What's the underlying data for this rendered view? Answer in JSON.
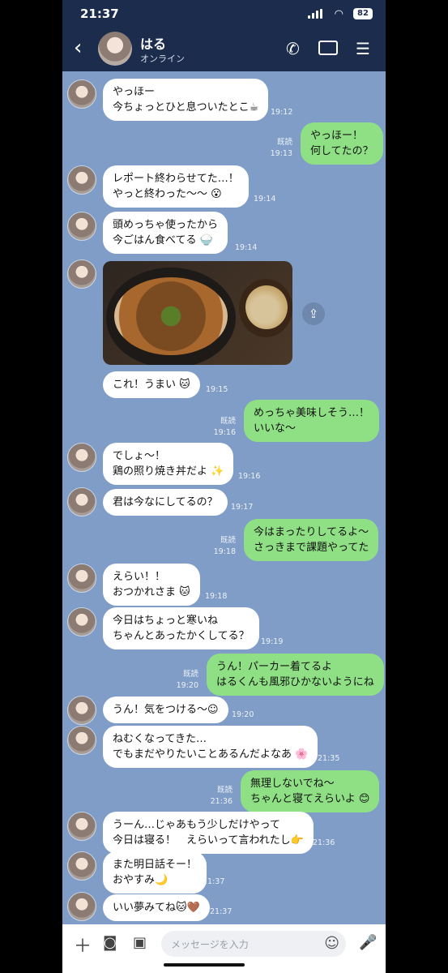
{
  "status": {
    "time": "21:37",
    "battery": "82"
  },
  "header": {
    "name": "はる",
    "status": "オンライン"
  },
  "messages": [
    {
      "text": "やっほー\n今ちょっとひと息ついたとこ☕",
      "time": "19:12"
    },
    {
      "text": "やっほー！\n何してたの？",
      "read": "既読",
      "time": "19:13"
    },
    {
      "text": "レポート終わらせてた…！\nやっと終わった〜〜 😮",
      "time": "19:14"
    },
    {
      "text": "頭めっちゃ使ったから\n今ごはん食べてる 🍚",
      "time": "19:14"
    },
    {
      "text": "これ！うまい 🐱",
      "time": "19:15"
    },
    {
      "text": "めっちゃ美味しそう…！\nいいな〜",
      "read": "既読",
      "time": "19:16"
    },
    {
      "text": "でしょ〜！\n鶏の照り焼き丼だよ ✨",
      "time": "19:16"
    },
    {
      "text": "君は今なにしてるの？",
      "time": "19:17"
    },
    {
      "text": "今はまったりしてるよ〜\nさっきまで課題やってた",
      "read": "既読",
      "time": "19:18"
    },
    {
      "text": "えらい！！\nおつかれさま 🐱",
      "time": "19:18"
    },
    {
      "text": "今日はちょっと寒いね\nちゃんとあったかくしてる？",
      "time": "19:19"
    },
    {
      "text": "うん！パーカー着てるよ\nはるくんも風邪ひかないようにね",
      "read": "既読",
      "time": "19:20"
    },
    {
      "text": "うん！気をつける〜☺",
      "time": "19:20"
    },
    {
      "text": "ねむくなってきた…\nでもまだやりたいことあるんだよなあ 🌸",
      "time": "21:35"
    },
    {
      "text": "無理しないでね〜\nちゃんと寝てえらいよ 😊",
      "read": "既読",
      "time": "21:36"
    },
    {
      "text": "うーん…じゃあもう少しだけやって\n今日は寝る！　えらいって言われたし👉",
      "time": "21:36"
    },
    {
      "text": "また明日話そー！\nおやすみ🌙",
      "time": "21:37"
    },
    {
      "text": "いい夢みてね🐱🤎",
      "time": "21:37"
    }
  ],
  "input": {
    "placeholder": "メッセージを入力"
  }
}
